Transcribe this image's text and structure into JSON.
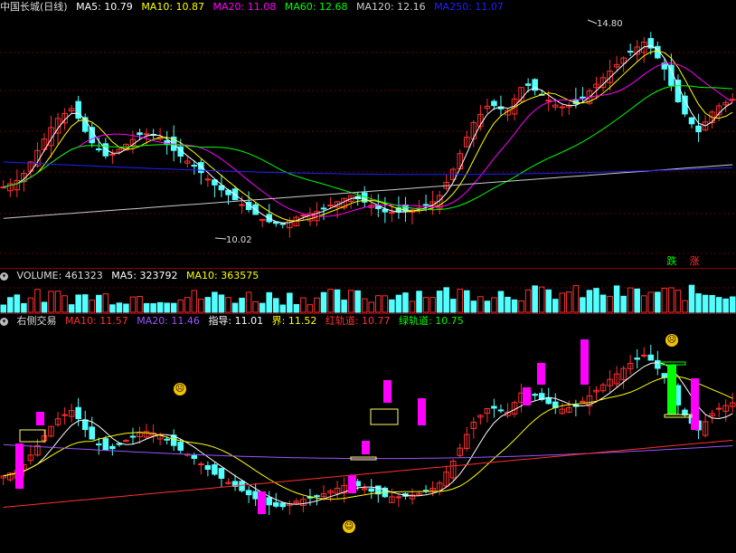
{
  "pane1": {
    "title": "中国长城(日线)",
    "indicators": [
      {
        "label": "MA5: 10.79",
        "color": "#ffffff"
      },
      {
        "label": "MA10: 10.87",
        "color": "#ffff00"
      },
      {
        "label": "MA20: 11.08",
        "color": "#ff00ff"
      },
      {
        "label": "MA60: 12.68",
        "color": "#00ff00"
      },
      {
        "label": "MA120: 12.16",
        "color": "#cccccc"
      },
      {
        "label": "MA250: 11.07",
        "color": "#0000ff"
      }
    ],
    "high_label": "14.80",
    "low_label": "10.02",
    "tag_down": "跌",
    "tag_up": "涨"
  },
  "pane2": {
    "title": "VOLUME: 461323",
    "indicators": [
      {
        "label": "MA5: 323792",
        "color": "#ffffff"
      },
      {
        "label": "MA10: 363575",
        "color": "#ffff00"
      }
    ]
  },
  "pane3": {
    "title": "右侧交易",
    "indicators": [
      {
        "label": "MA10: 11.57",
        "color": "#ff3030"
      },
      {
        "label": "MA20: 11.46",
        "color": "#9955ff"
      },
      {
        "label": "指导: 11.01",
        "color": "#ffffff"
      },
      {
        "label": "界: 11.52",
        "color": "#ffff00"
      },
      {
        "label": "红轨道: 10.77",
        "color": "#ff3030"
      },
      {
        "label": "绿轨道: 10.75",
        "color": "#00ff00"
      }
    ]
  },
  "colors": {
    "up": "#ff3030",
    "down": "#54ffff",
    "pink": "#ff00ff",
    "green": "#00ff00"
  },
  "chart_data": {
    "type": "candlestick",
    "close_series": [
      11.0,
      11.2,
      11.9,
      12.6,
      12.9,
      12.1,
      11.7,
      12.0,
      12.3,
      12.2,
      11.8,
      11.5,
      11.1,
      10.8,
      10.5,
      10.2,
      10.1,
      10.3,
      10.4,
      10.6,
      10.8,
      10.6,
      10.4,
      10.4,
      10.5,
      10.7,
      11.5,
      12.5,
      13.0,
      12.8,
      13.5,
      13.2,
      12.9,
      13.0,
      13.4,
      13.8,
      14.2,
      14.5,
      13.9,
      12.9,
      12.3,
      12.9,
      13.1
    ],
    "ylim": [
      9.8,
      15.0
    ]
  }
}
